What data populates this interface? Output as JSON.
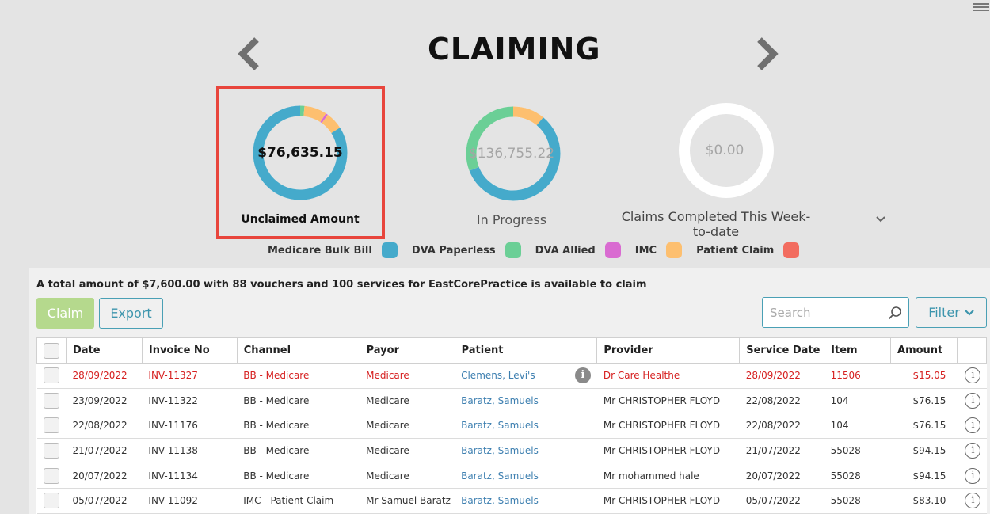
{
  "page": {
    "title": "CLAIMING"
  },
  "donuts": {
    "unclaimed": {
      "value": "$76,635.15",
      "label": "Unclaimed Amount",
      "segments": [
        {
          "category": "Medicare Bulk Bill",
          "share": 0.84,
          "color": "#45aacb"
        },
        {
          "category": "DVA Paperless",
          "share": 0.015,
          "color": "#6bcf96"
        },
        {
          "category": "Patient Claim",
          "share": 0.06,
          "color": "#fdbf6f"
        },
        {
          "category": "DVA Allied",
          "share": 0.008,
          "color": "#d96bd1"
        },
        {
          "category": "Patient Claim",
          "share": 0.077,
          "color": "#fdbf6f"
        }
      ]
    },
    "progress": {
      "value": "$136,755.22",
      "label": "In Progress",
      "segments": [
        {
          "category": "Medicare Bulk Bill",
          "share": 0.58,
          "color": "#45aacb"
        },
        {
          "category": "DVA Paperless",
          "share": 0.31,
          "color": "#6bcf96"
        },
        {
          "category": "Patient Claim",
          "share": 0.11,
          "color": "#fdbf6f"
        }
      ]
    },
    "completed": {
      "value": "$0.00",
      "label": "Claims Completed This Week-to-date",
      "segments": []
    }
  },
  "legend": [
    {
      "label": "Medicare Bulk Bill",
      "color": "#45aacb"
    },
    {
      "label": "DVA Paperless",
      "color": "#6bcf96"
    },
    {
      "label": "DVA Allied",
      "color": "#d96bd1"
    },
    {
      "label": "IMC",
      "color": "#fdbf6f"
    },
    {
      "label": "Patient Claim",
      "color": "#f26c5f"
    }
  ],
  "summary": "A total amount of $7,600.00 with 88 vouchers and 100 services for EastCorePractice is available to claim",
  "toolbar": {
    "claim_label": "Claim",
    "export_label": "Export",
    "search_placeholder": "Search",
    "filter_label": "Filter"
  },
  "table": {
    "columns": [
      "Date",
      "Invoice No",
      "Channel",
      "Payor",
      "Patient",
      "Provider",
      "Service Date",
      "Item",
      "Amount"
    ],
    "rows": [
      {
        "date": "28/09/2022",
        "invoice": "INV-11327",
        "channel": "BB - Medicare",
        "payor": "Medicare",
        "patient": "Clemens, Levi's",
        "provider": "Dr Care Healthe",
        "service_date": "28/09/2022",
        "item": "11506",
        "amount": "$15.05",
        "alert": true,
        "patient_info": true
      },
      {
        "date": "23/09/2022",
        "invoice": "INV-11322",
        "channel": "BB - Medicare",
        "payor": "Medicare",
        "patient": "Baratz, Samuels",
        "provider": "Mr CHRISTOPHER FLOYD",
        "service_date": "22/08/2022",
        "item": "104",
        "amount": "$76.15",
        "alert": false,
        "patient_info": false
      },
      {
        "date": "22/08/2022",
        "invoice": "INV-11176",
        "channel": "BB - Medicare",
        "payor": "Medicare",
        "patient": "Baratz, Samuels",
        "provider": "Mr CHRISTOPHER FLOYD",
        "service_date": "22/08/2022",
        "item": "104",
        "amount": "$76.15",
        "alert": false,
        "patient_info": false
      },
      {
        "date": "21/07/2022",
        "invoice": "INV-11138",
        "channel": "BB - Medicare",
        "payor": "Medicare",
        "patient": "Baratz, Samuels",
        "provider": "Mr CHRISTOPHER FLOYD",
        "service_date": "21/07/2022",
        "item": "55028",
        "amount": "$94.15",
        "alert": false,
        "patient_info": false
      },
      {
        "date": "20/07/2022",
        "invoice": "INV-11134",
        "channel": "BB - Medicare",
        "payor": "Medicare",
        "patient": "Baratz, Samuels",
        "provider": "Mr mohammed hale",
        "service_date": "20/07/2022",
        "item": "55028",
        "amount": "$94.15",
        "alert": false,
        "patient_info": false
      },
      {
        "date": "05/07/2022",
        "invoice": "INV-11092",
        "channel": "IMC - Patient Claim",
        "payor": "Mr Samuel Baratz",
        "patient": "Baratz, Samuels",
        "provider": "Mr CHRISTOPHER FLOYD",
        "service_date": "05/07/2022",
        "item": "55028",
        "amount": "$83.10",
        "alert": false,
        "patient_info": false
      }
    ]
  }
}
